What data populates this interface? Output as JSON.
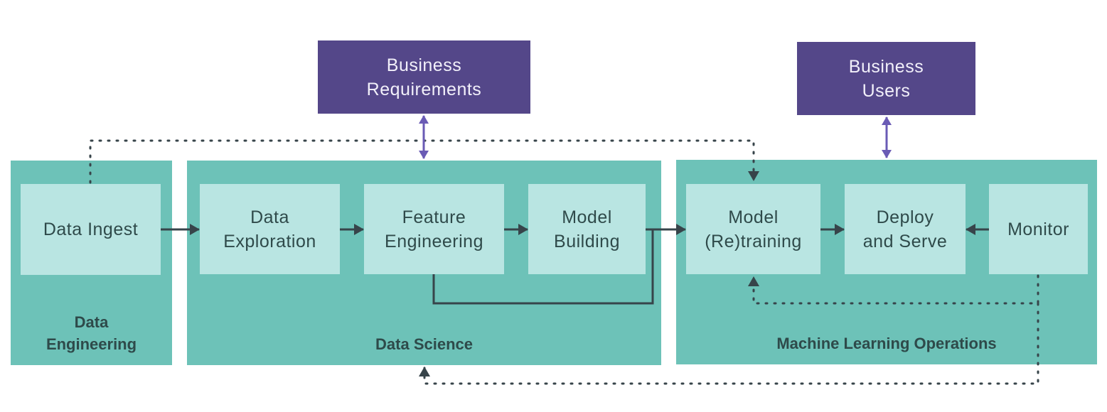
{
  "diagram": {
    "colors": {
      "group_fill": "#6dc2b8",
      "node_fill": "#b9e5e2",
      "business_fill": "#544789",
      "arrow_dark": "#37444a",
      "arrow_purple": "#6a5bb5"
    },
    "business_boxes": {
      "requirements": "Business\nRequirements",
      "users": "Business\nUsers"
    },
    "groups": {
      "data_engineering": {
        "label": "Data\nEngineering",
        "nodes": {
          "data_ingest": "Data Ingest"
        }
      },
      "data_science": {
        "label": "Data Science",
        "nodes": {
          "data_exploration": "Data\nExploration",
          "feature_engineering": "Feature\nEngineering",
          "model_building": "Model\nBuilding"
        }
      },
      "mlops": {
        "label": "Machine Learning Operations",
        "nodes": {
          "model_retraining": "Model\n(Re)training",
          "deploy_serve": "Deploy\nand Serve",
          "monitor": "Monitor"
        }
      }
    },
    "edges": [
      {
        "from": "Data Ingest",
        "to": "Data Exploration",
        "style": "solid"
      },
      {
        "from": "Data Exploration",
        "to": "Feature Engineering",
        "style": "solid"
      },
      {
        "from": "Feature Engineering",
        "to": "Model Building",
        "style": "solid"
      },
      {
        "from": "Model Building",
        "to": "Model (Re)training",
        "style": "solid"
      },
      {
        "from": "Feature Engineering",
        "to": "Model (Re)training",
        "style": "solid"
      },
      {
        "from": "Model (Re)training",
        "to": "Deploy and Serve",
        "style": "solid"
      },
      {
        "from": "Monitor",
        "to": "Deploy and Serve",
        "style": "solid"
      },
      {
        "from": "Data Ingest",
        "to": "Model (Re)training",
        "style": "dotted"
      },
      {
        "from": "Monitor",
        "to": "Model (Re)training",
        "style": "dotted"
      },
      {
        "from": "Monitor",
        "to": "Data Science",
        "style": "dotted"
      },
      {
        "from": "Business Requirements",
        "to": "Data Science",
        "style": "bidirectional"
      },
      {
        "from": "Business Users",
        "to": "Machine Learning Operations",
        "style": "bidirectional"
      }
    ]
  }
}
